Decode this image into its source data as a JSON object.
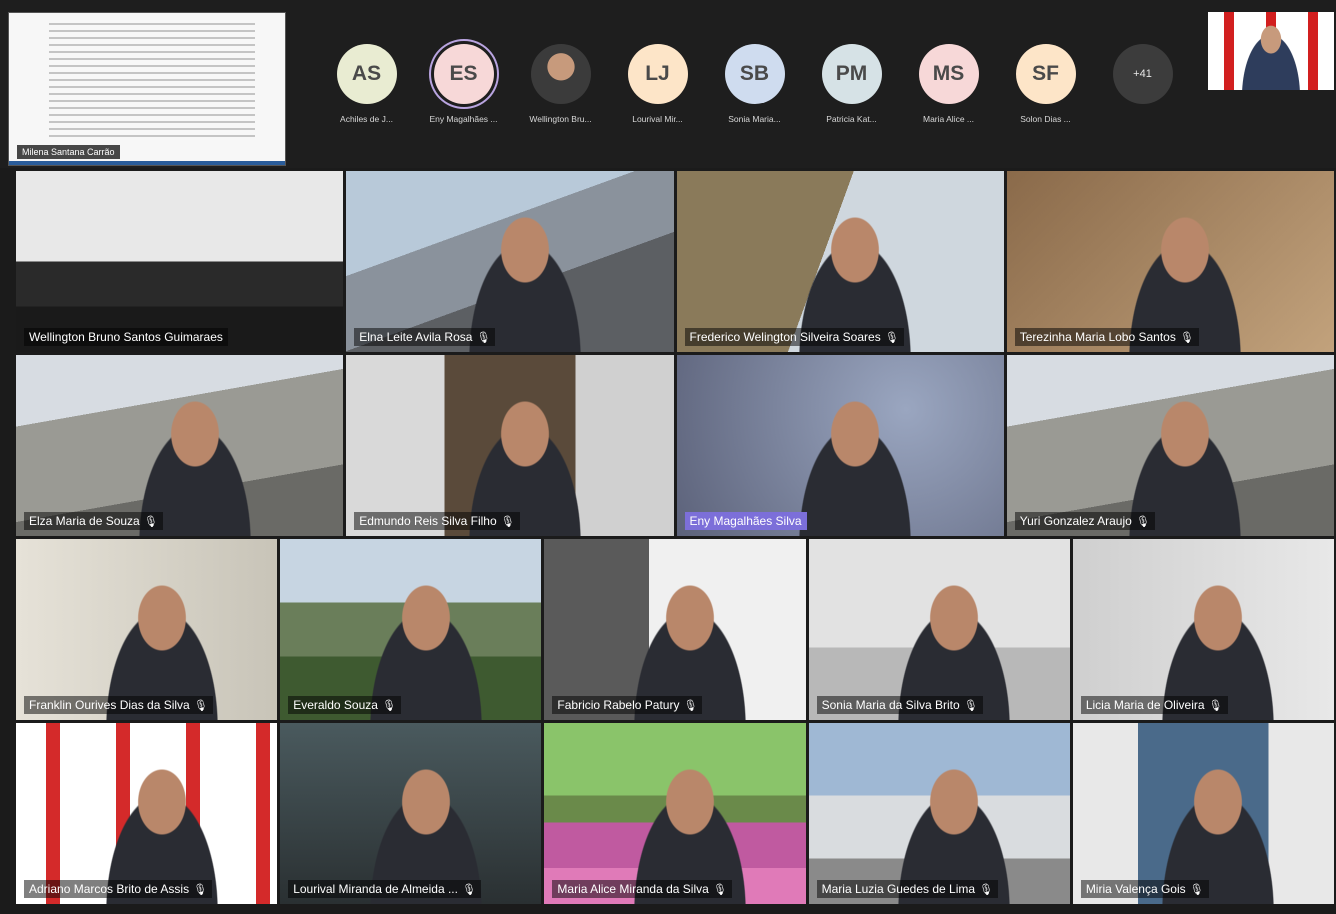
{
  "shared_screen": {
    "presenter_name": "Milena Santana Carrão"
  },
  "attendees": [
    {
      "initials": "AS",
      "name": "Achiles de J...",
      "color": "#e9ecd2"
    },
    {
      "initials": "ES",
      "name": "Eny Magalhães ...",
      "color": "#f7d8d8",
      "selected": true
    },
    {
      "initials": "",
      "name": "Wellington Bru...",
      "photo": true
    },
    {
      "initials": "LJ",
      "name": "Lourival Mir...",
      "color": "#fde5c8"
    },
    {
      "initials": "SB",
      "name": "Sonia Maria...",
      "color": "#cfdcef"
    },
    {
      "initials": "PM",
      "name": "Patricia Kat...",
      "color": "#d6e2e6"
    },
    {
      "initials": "MS",
      "name": "Maria Alice ...",
      "color": "#f7d8d8"
    },
    {
      "initials": "SF",
      "name": "Solon Dias ...",
      "color": "#fde5c8"
    },
    {
      "initials": "+41",
      "name": "",
      "more": true
    }
  ],
  "grid": {
    "rows": [
      [
        {
          "name": "Wellington Bruno Santos Guimaraes",
          "bg": "bg-conf",
          "person": false,
          "mic": false
        },
        {
          "name": "Elna Leite Avila Rosa",
          "bg": "bg-bldg",
          "mic": true
        },
        {
          "name": "Frederico Welington Silveira Soares",
          "bg": "bg-office",
          "mic": true
        },
        {
          "name": "Terezinha Maria Lobo Santos",
          "bg": "bg-table",
          "mic": true
        }
      ],
      [
        {
          "name": "Elza Maria de Souza",
          "bg": "bg-building2",
          "mic": true
        },
        {
          "name": "Edmundo Reis Silva Filho",
          "bg": "bg-shelf",
          "mic": true
        },
        {
          "name": "Eny Magalhães Silva",
          "bg": "bg-blur",
          "highlight": true,
          "mic": false
        },
        {
          "name": "Yuri Gonzalez Araujo",
          "bg": "bg-building2",
          "mic": true
        }
      ],
      [
        {
          "name": "Franklin Ourives Dias da Silva",
          "bg": "bg-light",
          "mic": true
        },
        {
          "name": "Everaldo Souza",
          "bg": "bg-mount",
          "mic": true
        },
        {
          "name": "Fabricio Rabelo Patury",
          "bg": "bg-logo",
          "mic": true
        },
        {
          "name": "Sonia Maria da Silva Brito",
          "bg": "bg-room",
          "mic": true
        },
        {
          "name": "Licia Maria de Oliveira",
          "bg": "bg-wall",
          "mic": true
        }
      ],
      [
        {
          "name": "Adriano Marcos Brito de Assis",
          "bg": "bg-brand",
          "mic": true
        },
        {
          "name": "Lourival Miranda de Almeida ...",
          "bg": "bg-dark",
          "mic": true
        },
        {
          "name": "Maria Alice Miranda da Silva",
          "bg": "bg-tulip",
          "mic": true
        },
        {
          "name": "Maria Luzia Guedes de Lima",
          "bg": "bg-campus",
          "mic": true
        },
        {
          "name": "Miria Valença Gois",
          "bg": "bg-poster",
          "mic": true
        }
      ]
    ]
  }
}
